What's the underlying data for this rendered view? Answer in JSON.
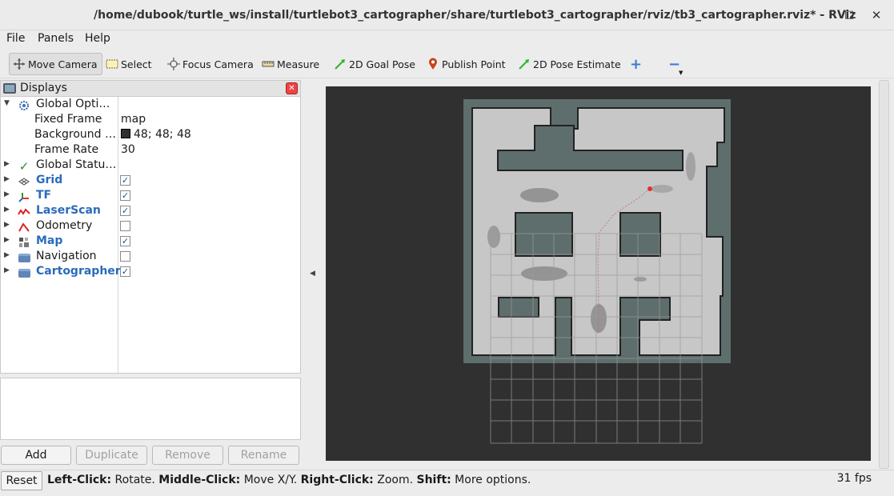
{
  "window": {
    "title": "/home/dubook/turtle_ws/install/turtlebot3_cartographer/share/turtlebot3_cartographer/rviz/tb3_cartographer.rviz* - RViz",
    "controls": [
      "minimize-icon",
      "maximize-icon",
      "close-icon"
    ]
  },
  "menu": {
    "file": "File",
    "panels": "Panels",
    "help": "Help"
  },
  "toolbar": {
    "move_camera": "Move Camera",
    "select": "Select",
    "focus_camera": "Focus Camera",
    "measure": "Measure",
    "goal_pose": "2D Goal Pose",
    "publish_point": "Publish Point",
    "pose_estimate": "2D Pose Estimate",
    "add_tool": "+",
    "remove_tool": "−"
  },
  "displays": {
    "title": "Displays",
    "items": [
      {
        "name": "Global Opti…",
        "icon": "gear-icon",
        "expanded": true
      },
      {
        "name": "Fixed Frame",
        "value": "map"
      },
      {
        "name": "Background …",
        "value": "48; 48; 48",
        "color": "#303030"
      },
      {
        "name": "Frame Rate",
        "value": "30"
      },
      {
        "name": "Global Statu…",
        "icon": "checkmark-icon"
      },
      {
        "name": "Grid",
        "icon": "grid-icon",
        "checked": true
      },
      {
        "name": "TF",
        "icon": "tf-icon",
        "checked": true
      },
      {
        "name": "LaserScan",
        "icon": "laserscan-icon",
        "checked": true
      },
      {
        "name": "Odometry",
        "icon": "odometry-icon",
        "checked": false
      },
      {
        "name": "Map",
        "icon": "map-icon",
        "checked": true
      },
      {
        "name": "Navigation",
        "icon": "folder-icon",
        "checked": false
      },
      {
        "name": "Cartographer",
        "icon": "folder-icon",
        "checked": true
      }
    ]
  },
  "buttons": {
    "add": "Add",
    "duplicate": "Duplicate",
    "remove": "Remove",
    "rename": "Rename"
  },
  "status": {
    "reset": "Reset",
    "left_click": "Left-Click:",
    "left_click_action": " Rotate. ",
    "middle_click": "Middle-Click:",
    "middle_click_action": " Move X/Y. ",
    "right_click": "Right-Click:",
    "right_click_action": " Zoom. ",
    "shift": "Shift:",
    "shift_action": " More options.",
    "fps": "31 fps"
  },
  "colors": {
    "viewport_bg": "#303030",
    "map_free": "#c6c6c6",
    "map_unknown": "#5e6e6c",
    "link_blue": "#2a6bbd"
  }
}
